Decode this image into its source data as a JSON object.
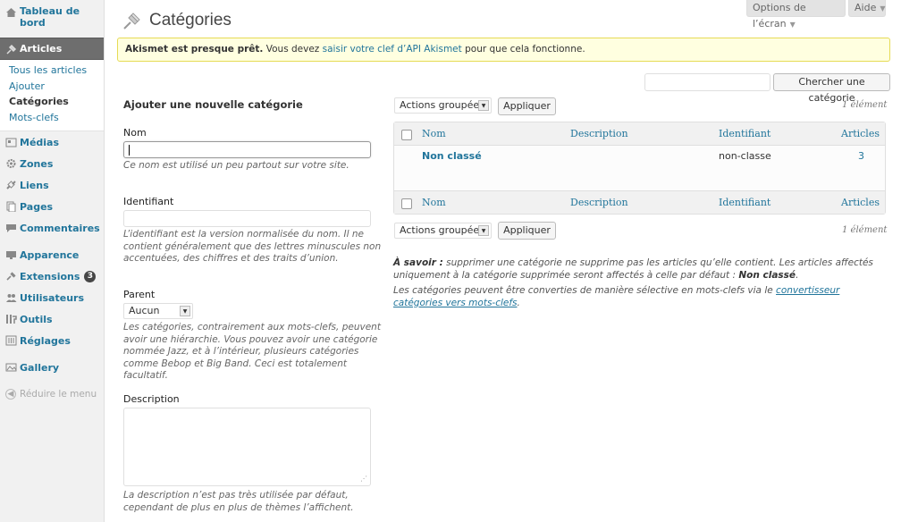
{
  "sidebar": {
    "dashboard": "Tableau de bord",
    "articles": "Articles",
    "articles_sub": [
      "Tous les articles",
      "Ajouter",
      "Catégories",
      "Mots-clefs"
    ],
    "medias": "Médias",
    "zones": "Zones",
    "liens": "Liens",
    "pages": "Pages",
    "commentaires": "Commentaires",
    "apparence": "Apparence",
    "extensions": "Extensions",
    "extensions_badge": "3",
    "utilisateurs": "Utilisateurs",
    "outils": "Outils",
    "reglages": "Réglages",
    "gallery": "Gallery",
    "collapse": "Réduire le menu"
  },
  "screen_options": "Options de l’écran",
  "help_tab": "Aide",
  "page_title": "Catégories",
  "notice": {
    "bold": "Akismet est presque prêt.",
    "text_before": " Vous devez ",
    "link": "saisir votre clef d’API Akismet",
    "text_after": " pour que cela fonctionne."
  },
  "search": {
    "button": "Chercher une catégorie",
    "value": ""
  },
  "form": {
    "title": "Ajouter une nouvelle catégorie",
    "nom_label": "Nom",
    "nom_value": "",
    "nom_help": "Ce nom est utilisé un peu partout sur votre site.",
    "identifiant_label": "Identifiant",
    "identifiant_value": "",
    "identifiant_help": "L’identifiant est la version normalisée du nom. Il ne contient généralement que des lettres minuscules non accentuées, des chiffres et des traits d’union.",
    "parent_label": "Parent",
    "parent_value": "Aucun",
    "parent_help": "Les catégories, contrairement aux mots-clefs, peuvent avoir une hiérarchie. Vous pouvez avoir une catégorie nommée Jazz, et à l’intérieur, plusieurs catégories comme Bebop et Big Band. Ceci est totalement facultatif.",
    "description_label": "Description",
    "description_value": "",
    "description_help": "La description n’est pas très utilisée par défaut, cependant de plus en plus de thèmes l’affichent."
  },
  "bulk": {
    "select": "Actions groupées",
    "apply": "Appliquer",
    "count": "1 élément"
  },
  "table": {
    "headers": [
      "Nom",
      "Description",
      "Identifiant",
      "Articles"
    ],
    "rows": [
      {
        "name": "Non classé",
        "description": "",
        "slug": "non-classe",
        "count": "3"
      }
    ]
  },
  "notes": {
    "savoir_label": "À savoir :",
    "savoir_text": " supprimer une catégorie ne supprime pas les articles qu’elle contient. Les articles affectés uniquement à la catégorie supprimée seront affectés à celle par défaut  : ",
    "savoir_default": "Non classé",
    "savoir_end": ".",
    "convert_text": "Les catégories peuvent être converties de manière sélective en mots-clefs via le ",
    "convert_link": "convertisseur catégories vers mots-clefs",
    "convert_end": "."
  },
  "colors": {
    "link": "#21759b",
    "active_menu": "#6e6e6e",
    "notice_bg": "#ffffe0",
    "notice_border": "#e6db55"
  }
}
